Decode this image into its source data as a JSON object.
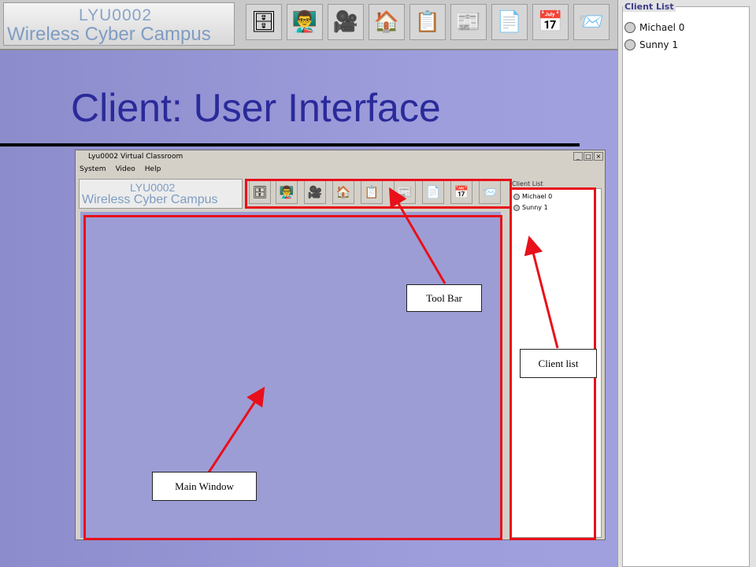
{
  "banner": {
    "logo_line1": "LYU0002",
    "logo_line2": "Wireless Cyber Campus",
    "tools": [
      {
        "icon": "cabinet-icon"
      },
      {
        "icon": "teacher-icon"
      },
      {
        "icon": "camera-icon"
      },
      {
        "icon": "house-icon"
      },
      {
        "icon": "clipboard-icon"
      },
      {
        "icon": "news-icon"
      },
      {
        "icon": "pdf-icon"
      },
      {
        "icon": "calendar-icon"
      },
      {
        "icon": "mail-icon"
      }
    ]
  },
  "client_list_panel": {
    "legend": "Client List",
    "clients": [
      "Michael 0",
      "Sunny 1"
    ]
  },
  "slide": {
    "title": "Client: User Interface"
  },
  "window": {
    "title": "Lyu0002 Virtual Classroom",
    "controls": [
      "_",
      "□",
      "×"
    ],
    "menu": [
      "System",
      "Video",
      "Help"
    ],
    "logo_line1": "LYU0002",
    "logo_line2": "Wireless Cyber Campus",
    "client_list_legend": "Client List",
    "clients": [
      "Michael 0",
      "Sunny 1"
    ]
  },
  "callouts": {
    "toolbar": "Tool Bar",
    "client_list": "Client list",
    "main_window": "Main Window"
  },
  "colors": {
    "highlight": "#e8101a",
    "title": "#2a2a9a"
  }
}
